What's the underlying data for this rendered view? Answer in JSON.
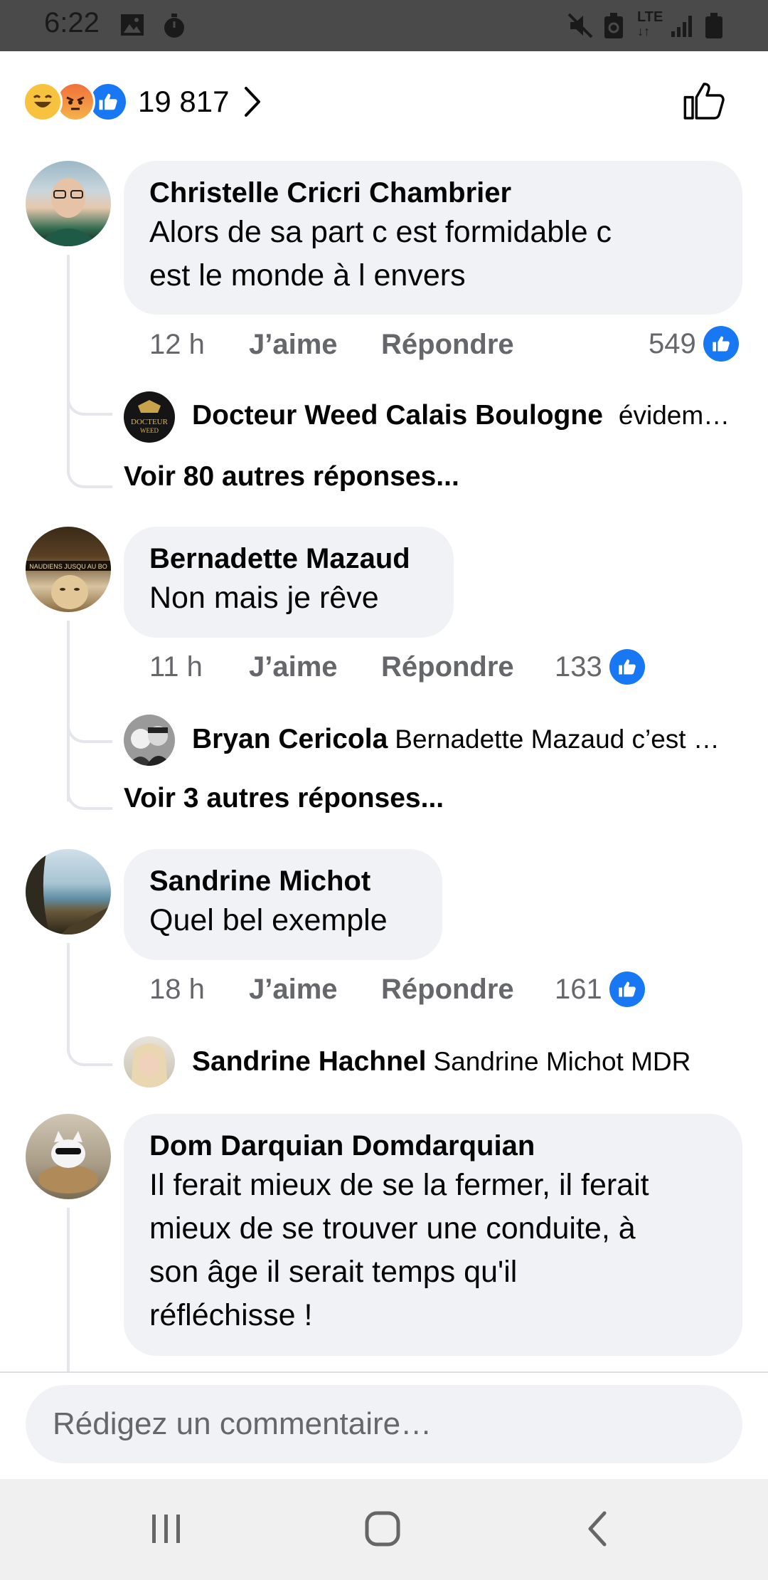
{
  "status_bar": {
    "time": "6:22",
    "icons": [
      "image-icon",
      "stopwatch-icon",
      "mute-icon",
      "battery-saver-icon",
      "lte-icon",
      "signal-icon",
      "battery-icon"
    ],
    "network": "LTE"
  },
  "header": {
    "reaction_icons": [
      "haha-icon",
      "angry-icon",
      "like-icon"
    ],
    "reaction_count": "19 817"
  },
  "comments": [
    {
      "author": "Christelle Cricri Chambrier",
      "lines": [
        "Alors de sa part c est formidable c",
        "est le monde à l envers"
      ],
      "time": "12 h",
      "like_label": "J’aime",
      "reply_label": "Répondre",
      "likes": "549",
      "reply_preview": {
        "author": "Docteur Weed Calais Boulogne",
        "text": "évidem…"
      },
      "more_replies": "Voir 80 autres réponses..."
    },
    {
      "author": "Bernadette Mazaud",
      "lines": [
        "Non mais je rêve"
      ],
      "time": "11 h",
      "like_label": "J’aime",
      "reply_label": "Répondre",
      "likes": "133",
      "reply_preview": {
        "author": "Bryan Cericola",
        "text": "Bernadette Mazaud c’est …"
      },
      "more_replies": "Voir 3 autres réponses..."
    },
    {
      "author": "Sandrine Michot",
      "lines": [
        "Quel bel exemple"
      ],
      "time": "18 h",
      "like_label": "J’aime",
      "reply_label": "Répondre",
      "likes": "161",
      "reply_preview": {
        "author": "Sandrine Hachnel",
        "text": "Sandrine Michot MDR"
      }
    },
    {
      "author": "Dom Darquian Domdarquian",
      "lines": [
        "Il ferait mieux de se la fermer, il ferait",
        "mieux de se trouver une conduite, à",
        "son âge il serait temps qu'il",
        "réfléchisse !"
      ]
    }
  ],
  "composer": {
    "placeholder": "Rédigez un commentaire…"
  },
  "nav": {
    "icons": [
      "recent-apps-icon",
      "home-icon",
      "back-icon"
    ]
  },
  "colors": {
    "like_blue": "#1877f2",
    "bubble_bg": "#f0f2f5",
    "meta_gray": "#65676b"
  }
}
